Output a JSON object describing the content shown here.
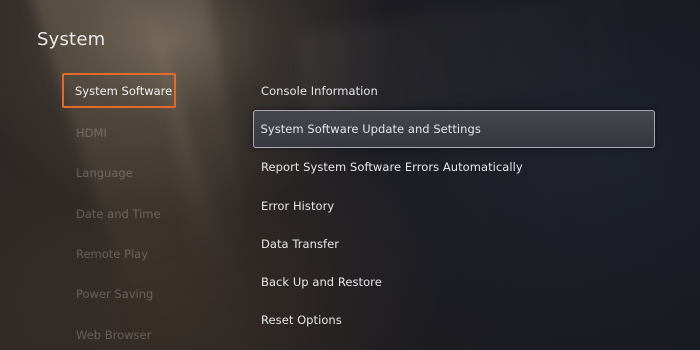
{
  "page": {
    "title": "System"
  },
  "sidebar": {
    "items": [
      {
        "label": "System Software",
        "selected": true
      },
      {
        "label": "HDMI",
        "selected": false
      },
      {
        "label": "Language",
        "selected": false
      },
      {
        "label": "Date and Time",
        "selected": false
      },
      {
        "label": "Remote Play",
        "selected": false
      },
      {
        "label": "Power Saving",
        "selected": false
      },
      {
        "label": "Web Browser",
        "selected": false
      }
    ],
    "highlight_color": "#e46a2b"
  },
  "menu": {
    "items": [
      {
        "label": "Console Information",
        "focused": false
      },
      {
        "label": "System Software Update and Settings",
        "focused": true
      },
      {
        "label": "Report System Software Errors Automatically",
        "focused": false
      },
      {
        "label": "Error History",
        "focused": false
      },
      {
        "label": "Data Transfer",
        "focused": false
      },
      {
        "label": "Back Up and Restore",
        "focused": false
      },
      {
        "label": "Reset Options",
        "focused": false
      }
    ]
  }
}
